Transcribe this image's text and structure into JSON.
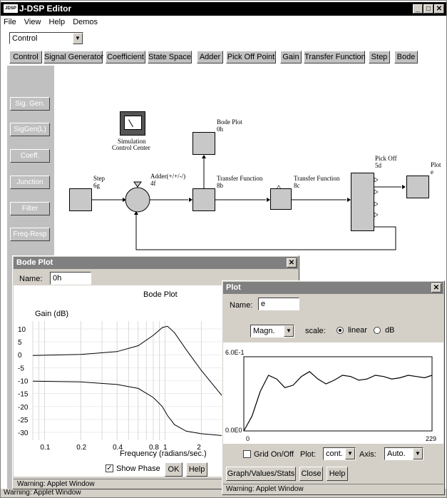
{
  "app": {
    "title": "J-DSP Editor",
    "icon_text": "JDSP"
  },
  "menu": [
    "File",
    "View",
    "Help",
    "Demos"
  ],
  "category_select": "Control",
  "toolbar": [
    "Control",
    "Signal Generator",
    "Coefficient",
    "State Space",
    "Adder",
    "Pick Off Point",
    "Gain",
    "Transfer Function",
    "Step",
    "Bode"
  ],
  "left_panel": [
    "Sig. Gen.",
    "SigGen(L)",
    "Coeff.",
    "Junction",
    "Filter",
    "Freq-Resp"
  ],
  "diagram": {
    "sim_center": [
      "Simulation",
      "Control Center"
    ],
    "bode_label": [
      "Bode Plot",
      "0h"
    ],
    "step_label": [
      "Step",
      "6g"
    ],
    "adder_label": [
      "Adder(+/+/-/)",
      "4f"
    ],
    "tf1_label": [
      "Transfer Function",
      "8b"
    ],
    "tf2_label": [
      "Transfer Function",
      "8c"
    ],
    "pickoff_label": [
      "Pick Off",
      "5d"
    ],
    "plot_label": [
      "Plot",
      "e"
    ]
  },
  "bode_window": {
    "title": "Bode Plot",
    "name_label": "Name:",
    "name_value": "0h",
    "plot_title": "Bode Plot",
    "ylabel": "Gain (dB)",
    "xlabel": "Frequency (radians/sec.)",
    "show_phase_label": "Show Phase",
    "show_phase_checked": true,
    "ok": "OK",
    "help": "Help",
    "warning": "Warning: Applet Window"
  },
  "plot_window": {
    "title": "Plot",
    "name_label": "Name:",
    "name_value": "e",
    "mode_select": "Magn.",
    "scale_label": "scale:",
    "scale_options": [
      "linear",
      "dB"
    ],
    "scale_selected": "linear",
    "y_top_label": "6.0E-1",
    "y_bottom_label": "0.0E0",
    "x_left_label": "0",
    "x_right_label": "229",
    "grid_label": "Grid On/Off",
    "plot_label": "Plot:",
    "plot_select": "cont.",
    "axis_label": "Axis:",
    "axis_select": "Auto.",
    "graph_btn": "Graph/Values/Stats",
    "close_btn": "Close",
    "help_btn": "Help",
    "warning": "Warning: Applet Window"
  },
  "bottom_warning": "Warning: Applet Window",
  "chart_data": [
    {
      "type": "line",
      "title": "Bode Plot",
      "ylabel": "Gain (dB)",
      "xlabel": "Frequency (radians/sec.)",
      "x_ticks": [
        "0.1",
        "0.2",
        "0.4",
        "0.8",
        "1",
        "2"
      ],
      "y_ticks": [
        "10",
        "5",
        "0",
        "-5",
        "-10",
        "-15",
        "-20",
        "-25",
        "-30"
      ],
      "ylim": [
        -33,
        13
      ],
      "xlim_log": [
        0.08,
        3
      ],
      "grid": true,
      "series": [
        {
          "x": [
            0.08,
            0.2,
            0.4,
            0.6,
            0.8,
            0.95,
            1.05,
            1.2,
            1.5,
            2.0,
            3.0
          ],
          "y": [
            -0.3,
            0.1,
            1.2,
            3.5,
            7.5,
            10.5,
            11.0,
            8.5,
            2.0,
            -6.0,
            -16.0
          ]
        },
        {
          "x": [
            0.08,
            0.2,
            0.4,
            0.6,
            0.8,
            0.95,
            1.05,
            1.2,
            1.5,
            2.0,
            3.0
          ],
          "y": [
            -10.2,
            -10.5,
            -11.5,
            -13.0,
            -16.5,
            -20.0,
            -23.5,
            -27.0,
            -29.5,
            -30.5,
            -31.2
          ]
        }
      ]
    },
    {
      "type": "line",
      "ylim": [
        0,
        0.6
      ],
      "xlim": [
        0,
        229
      ],
      "y_ticks": [
        "6.0E-1",
        "0.0E0"
      ],
      "x_ticks": [
        "0",
        "229"
      ],
      "series": [
        {
          "x": [
            0,
            10,
            20,
            30,
            40,
            50,
            60,
            70,
            80,
            90,
            100,
            110,
            120,
            130,
            140,
            150,
            160,
            170,
            180,
            190,
            200,
            210,
            220,
            229
          ],
          "y": [
            0.0,
            0.12,
            0.32,
            0.45,
            0.42,
            0.35,
            0.37,
            0.44,
            0.48,
            0.42,
            0.38,
            0.41,
            0.45,
            0.44,
            0.41,
            0.42,
            0.45,
            0.44,
            0.42,
            0.43,
            0.45,
            0.44,
            0.43,
            0.45
          ]
        }
      ]
    }
  ]
}
